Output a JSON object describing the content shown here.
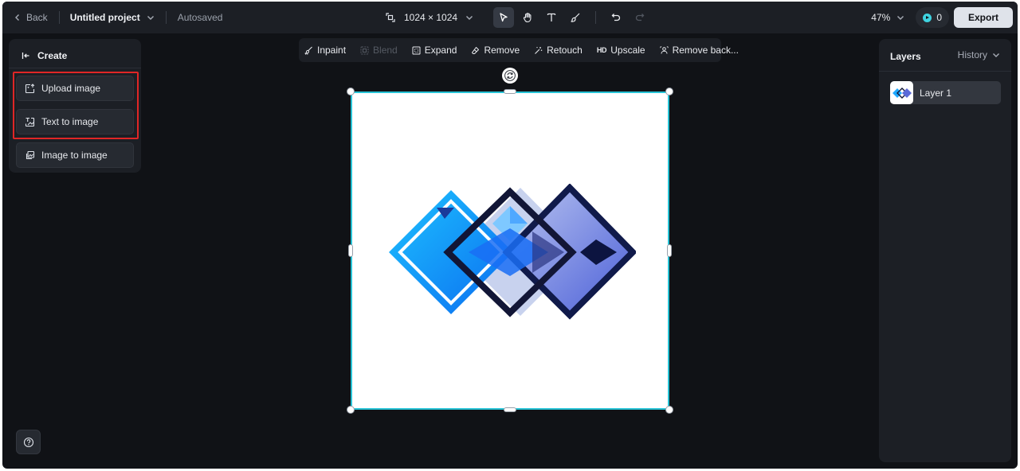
{
  "topbar": {
    "back_label": "Back",
    "project_name": "Untitled project",
    "save_status": "Autosaved",
    "canvas_size": "1024 × 1024",
    "tools": [
      {
        "name": "select-tool",
        "icon": "pointer-icon",
        "active": true
      },
      {
        "name": "hand-tool",
        "icon": "hand-icon",
        "active": false
      },
      {
        "name": "text-tool",
        "icon": "text-icon",
        "active": false
      },
      {
        "name": "brush-tool",
        "icon": "brush-icon",
        "active": false
      }
    ],
    "zoom": "47%",
    "credits": "0",
    "export_label": "Export"
  },
  "left_panel": {
    "header": "Create",
    "buttons": [
      {
        "label": "Upload image",
        "icon": "image-upload-icon"
      },
      {
        "label": "Text to image",
        "icon": "text-image-icon"
      },
      {
        "label": "Image to image",
        "icon": "images-icon"
      }
    ]
  },
  "edit_toolbar": {
    "items": [
      {
        "label": "Inpaint",
        "icon": "inpaint-icon",
        "enabled": true
      },
      {
        "label": "Blend",
        "icon": "blend-icon",
        "enabled": false
      },
      {
        "label": "Expand",
        "icon": "expand-icon",
        "enabled": true
      },
      {
        "label": "Remove",
        "icon": "eraser-icon",
        "enabled": true
      },
      {
        "label": "Retouch",
        "icon": "retouch-icon",
        "enabled": true
      },
      {
        "label": "Upscale",
        "icon": "hd-icon",
        "enabled": true
      },
      {
        "label": "Remove back...",
        "icon": "person-cutout-icon",
        "enabled": true
      }
    ]
  },
  "layers_panel": {
    "title": "Layers",
    "history_label": "History",
    "layers": [
      {
        "name": "Layer 1"
      }
    ]
  },
  "colors": {
    "app_bg": "#101216",
    "panel_bg": "#1c1f25",
    "selection": "#27c3d6",
    "highlight": "#e02626",
    "accent": "#3fd3e0"
  }
}
